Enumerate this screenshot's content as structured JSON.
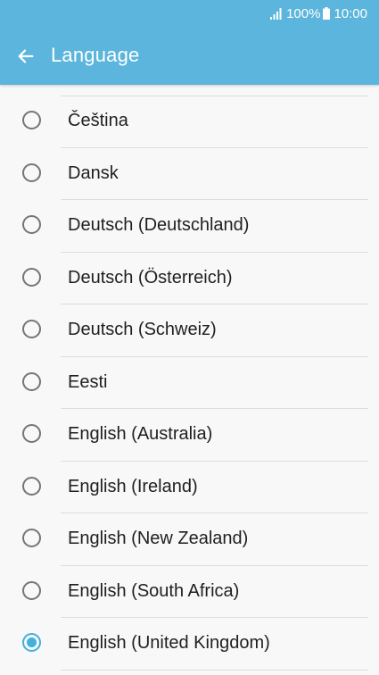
{
  "status_bar": {
    "battery_percent": "100%",
    "time": "10:00",
    "icons": [
      "signal-icon",
      "battery-icon"
    ]
  },
  "app_bar": {
    "title": "Language",
    "back_icon": "arrow-left-icon"
  },
  "colors": {
    "header": "#5bb5dc",
    "accent": "#40b0dc",
    "background": "#f8f8f8"
  },
  "languages": [
    {
      "label": "Čeština",
      "selected": false
    },
    {
      "label": "Dansk",
      "selected": false
    },
    {
      "label": "Deutsch (Deutschland)",
      "selected": false
    },
    {
      "label": "Deutsch (Österreich)",
      "selected": false
    },
    {
      "label": "Deutsch (Schweiz)",
      "selected": false
    },
    {
      "label": "Eesti",
      "selected": false
    },
    {
      "label": "English (Australia)",
      "selected": false
    },
    {
      "label": "English (Ireland)",
      "selected": false
    },
    {
      "label": "English (New Zealand)",
      "selected": false
    },
    {
      "label": "English (South Africa)",
      "selected": false
    },
    {
      "label": "English (United Kingdom)",
      "selected": true
    }
  ]
}
